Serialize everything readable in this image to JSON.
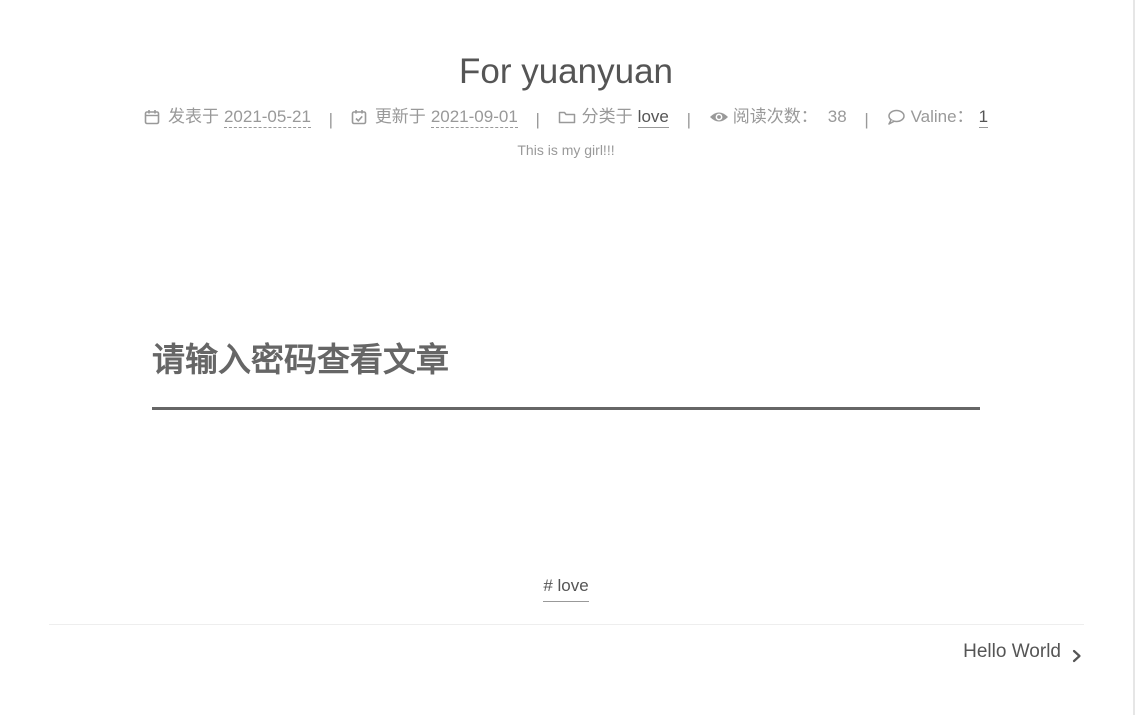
{
  "post": {
    "title": "For yuanyuan",
    "description": "This is my girl!!!"
  },
  "meta": {
    "posted_label": "发表于",
    "posted_date": "2021-05-21",
    "updated_label": "更新于",
    "updated_date": "2021-09-01",
    "category_label": "分类于",
    "category": "love",
    "views_label": "阅读次数：",
    "views_count": "38",
    "comments_label": "Valine：",
    "comments_count": "1",
    "divider": "|"
  },
  "content": {
    "password_prompt": "请输入密码查看文章"
  },
  "tags": {
    "tag1": "# love"
  },
  "navigation": {
    "next_post_label": "Hello World"
  },
  "icons": {
    "posted": "calendar-icon",
    "updated": "calendar-check-icon",
    "category": "folder-icon",
    "views": "eye-icon",
    "comments": "comment-icon",
    "next": "chevron-right-icon"
  },
  "colors": {
    "text": "#555555",
    "muted": "#999999",
    "heading": "#666666",
    "background": "#ffffff"
  }
}
